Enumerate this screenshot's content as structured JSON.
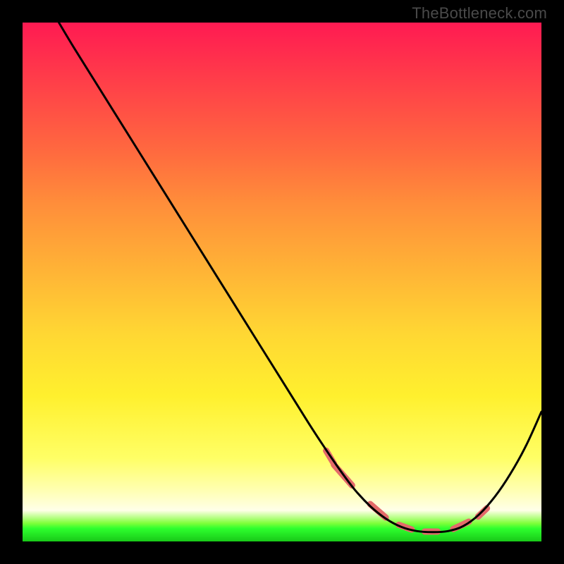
{
  "watermark": "TheBottleneck.com",
  "chart_data": {
    "type": "line",
    "title": "",
    "xlabel": "",
    "ylabel": "",
    "xlim": [
      0,
      100
    ],
    "ylim": [
      0,
      100
    ],
    "grid": false,
    "series": [
      {
        "name": "curve",
        "color": "#000000",
        "x": [
          7,
          10,
          15,
          20,
          25,
          30,
          35,
          40,
          45,
          50,
          55,
          58,
          61,
          64,
          67,
          70,
          73,
          76,
          79,
          82,
          85,
          88,
          91,
          94,
          97,
          100
        ],
        "values": [
          100,
          95,
          87,
          79,
          71,
          63,
          55,
          47,
          39,
          31,
          23,
          18.4,
          14,
          10,
          6.8,
          4.4,
          2.8,
          2.0,
          1.8,
          2.0,
          3.0,
          5.2,
          8.6,
          13,
          18.4,
          25
        ]
      }
    ],
    "markers": {
      "name": "highlight-segments",
      "color": "#e46a6a",
      "stroke_width": 9,
      "points_x": [
        60,
        63.5,
        67,
        70,
        72.5,
        75,
        77.5,
        80,
        83,
        86,
        88.5
      ],
      "points_y": [
        14.8,
        10.8,
        7.2,
        4.6,
        3.2,
        2.3,
        1.9,
        1.9,
        2.4,
        3.8,
        5.6
      ],
      "dash_lengths": [
        24,
        10,
        24,
        10,
        20,
        10,
        20,
        10,
        20,
        10,
        20
      ]
    }
  }
}
